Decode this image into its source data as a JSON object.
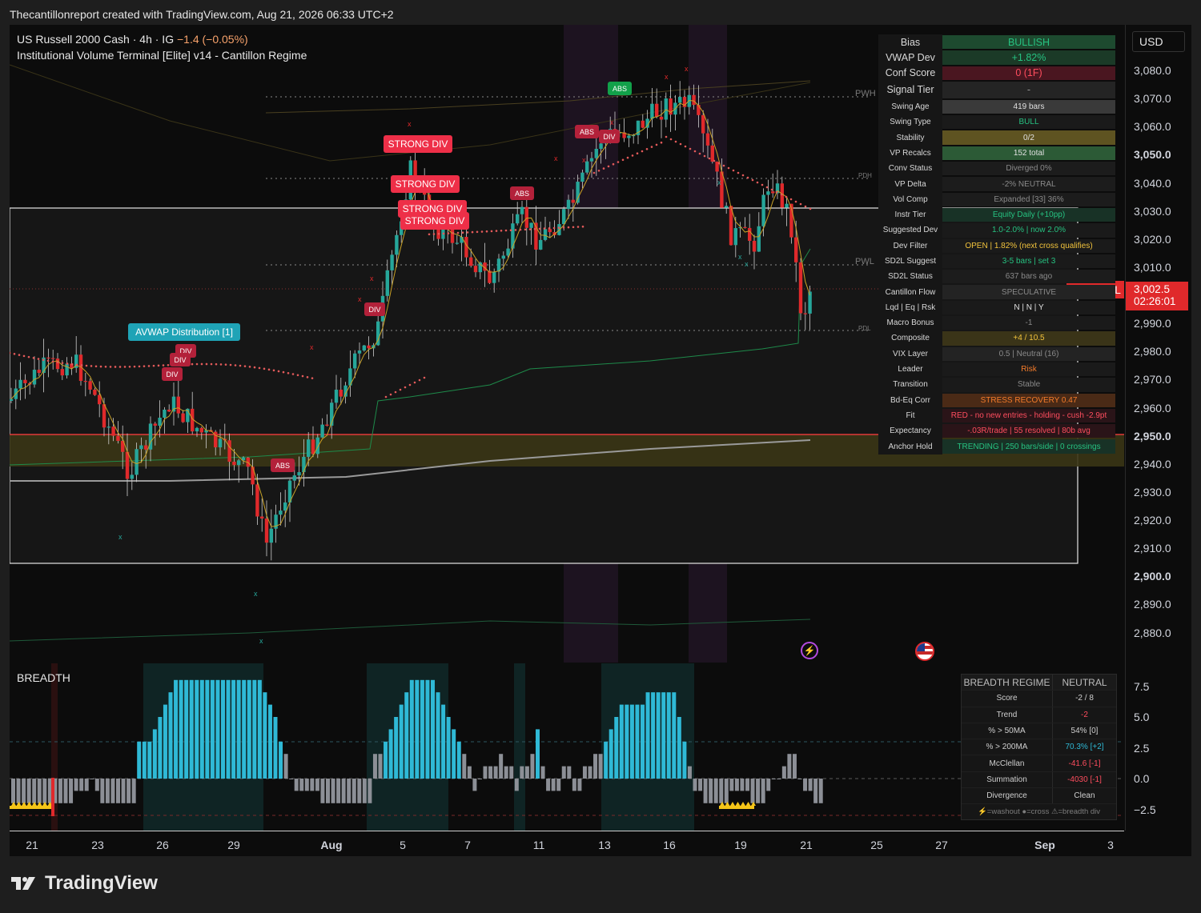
{
  "header": {
    "credit": "Thecantillonreport created with TradingView.com, Aug 21, 2026 06:33 UTC+2"
  },
  "symbol": {
    "title": "US Russell 2000 Cash · 4h · IG",
    "change": "−1.4 (−0.05%)"
  },
  "indicator": {
    "title": "Institutional Volume Terminal [Elite] v14 - Cantillon Regime"
  },
  "axis": {
    "currency": "USD",
    "price_labels": [
      {
        "v": 3080,
        "t": "3,080.0"
      },
      {
        "v": 3070,
        "t": "3,070.0"
      },
      {
        "v": 3060,
        "t": "3,060.0"
      },
      {
        "v": 3050,
        "t": "3,050.0",
        "bold": true
      },
      {
        "v": 3040,
        "t": "3,040.0"
      },
      {
        "v": 3030,
        "t": "3,030.0"
      },
      {
        "v": 3020,
        "t": "3,020.0"
      },
      {
        "v": 3010,
        "t": "3,010.0"
      },
      {
        "v": 2990,
        "t": "2,990.0"
      },
      {
        "v": 2980,
        "t": "2,980.0"
      },
      {
        "v": 2970,
        "t": "2,970.0"
      },
      {
        "v": 2960,
        "t": "2,960.0"
      },
      {
        "v": 2950,
        "t": "2,950.0",
        "bold": true
      },
      {
        "v": 2940,
        "t": "2,940.0"
      },
      {
        "v": 2930,
        "t": "2,930.0"
      },
      {
        "v": 2920,
        "t": "2,920.0"
      },
      {
        "v": 2910,
        "t": "2,910.0"
      },
      {
        "v": 2900,
        "t": "2,900.0",
        "bold": true
      },
      {
        "v": 2890,
        "t": "2,890.0"
      },
      {
        "v": 2880,
        "t": "2,880.0"
      }
    ],
    "last_price": "3,002.5",
    "countdown": "02:26:01",
    "price_tag_label": "RUSSELL",
    "breadth_labels": [
      "7.5",
      "5.0",
      "2.5",
      "0.0",
      "−2.5"
    ],
    "dates": [
      {
        "t": "21"
      },
      {
        "t": "23"
      },
      {
        "t": "26"
      },
      {
        "t": "29"
      },
      {
        "t": "Aug",
        "bold": true
      },
      {
        "t": "5"
      },
      {
        "t": "7"
      },
      {
        "t": "11"
      },
      {
        "t": "13"
      },
      {
        "t": "16"
      },
      {
        "t": "19"
      },
      {
        "t": "21"
      },
      {
        "t": "25"
      },
      {
        "t": "27"
      },
      {
        "t": "Sep",
        "bold": true
      },
      {
        "t": "3"
      }
    ]
  },
  "levels": {
    "pwh": "PWH",
    "pdh": "PDH",
    "pwl": "PWL",
    "pdl": "PDL"
  },
  "annotations": {
    "avwap": "AVWAP Distribution [1]",
    "strong_div": "STRONG DIV",
    "div": "DIV",
    "abs": "ABS",
    "x": "x"
  },
  "terminal": [
    {
      "k": "Bias",
      "v": "BULLISH",
      "c": "#26c281",
      "bg": "#1d4a2f",
      "big": true
    },
    {
      "k": "VWAP Dev",
      "v": "+1.82%",
      "c": "#26c281",
      "bg": "#1b3a27",
      "big": true
    },
    {
      "k": "Conf Score",
      "v": "0 (1F)",
      "c": "#ff4d5e",
      "bg": "#4a1620",
      "big": true
    },
    {
      "k": "Signal Tier",
      "v": "-",
      "c": "#9a9a9a",
      "bg": "#242424",
      "big": true
    },
    {
      "k": "Swing Age",
      "v": "419 bars",
      "c": "#e0e0e0",
      "bg": "#3a3a3a"
    },
    {
      "k": "Swing Type",
      "v": "BULL",
      "c": "#26c281",
      "bg": "#1a1a1a"
    },
    {
      "k": "Stability",
      "v": "0/2",
      "c": "#e0e0e0",
      "bg": "#5e5321"
    },
    {
      "k": "VP Recalcs",
      "v": "152 total",
      "c": "#e0e0e0",
      "bg": "#2c5a36"
    },
    {
      "k": "Conv Status",
      "v": "Diverged 0%",
      "c": "#8a8a8a",
      "bg": "#1c1c1c"
    },
    {
      "k": "VP Delta",
      "v": "-2% NEUTRAL",
      "c": "#8a8a8a",
      "bg": "#1c1c1c"
    },
    {
      "k": "Vol Comp",
      "v": "Expanded [33] 36%",
      "c": "#8a8a8a",
      "bg": "#1c1c1c"
    },
    {
      "k": "Instr Tier",
      "v": "Equity Daily (+10pp)",
      "c": "#26c281",
      "bg": "#183226"
    },
    {
      "k": "Suggested Dev",
      "v": "1.0-2.0% | now 2.0%",
      "c": "#26c281",
      "bg": "#1a1a1a"
    },
    {
      "k": "Dev Filter",
      "v": "OPEN | 1.82% (next cross qualifies)",
      "c": "#f2c33c",
      "bg": "#1a1a1a"
    },
    {
      "k": "SD2L Suggest",
      "v": "3-5 bars | set 3",
      "c": "#26c281",
      "bg": "#1a1a1a"
    },
    {
      "k": "SD2L Status",
      "v": "637 bars ago",
      "c": "#8a8a8a",
      "bg": "#1c1c1c"
    },
    {
      "k": "Cantillon Flow",
      "v": "SPECULATIVE",
      "c": "#8a8a8a",
      "bg": "#232323"
    },
    {
      "k": "Lqd | Eq | Rsk",
      "v": "N | N | Y",
      "c": "#e0e0e0",
      "bg": "#1a1a1a"
    },
    {
      "k": "Macro Bonus",
      "v": "-1",
      "c": "#8a8a8a",
      "bg": "#1a1a1a"
    },
    {
      "k": "Composite",
      "v": "+4 / 10.5",
      "c": "#f2c33c",
      "bg": "#3a3418"
    },
    {
      "k": "VIX Layer",
      "v": "0.5 | Neutral (16)",
      "c": "#8a8a8a",
      "bg": "#232323"
    },
    {
      "k": "Leader",
      "v": "Risk",
      "c": "#f57c2a",
      "bg": "#1a1a1a"
    },
    {
      "k": "Transition",
      "v": "Stable",
      "c": "#8a8a8a",
      "bg": "#1a1a1a"
    },
    {
      "k": "Bd-Eq Corr",
      "v": "STRESS RECOVERY 0.47",
      "c": "#f57c2a",
      "bg": "#4a2a16"
    },
    {
      "k": "Fit",
      "v": "RED - no new entries - holding - cush -2.9pt",
      "c": "#ff4d5e",
      "bg": "#2a1418"
    },
    {
      "k": "Expectancy",
      "v": "-.03R/trade | 55 resolved | 80b avg",
      "c": "#ff4d5e",
      "bg": "#2a1418"
    },
    {
      "k": "Anchor Hold",
      "v": "TRENDING | 250 bars/side | 0 crossings",
      "c": "#26c281",
      "bg": "#183226"
    }
  ],
  "breadth": {
    "label": "BREADTH",
    "header": {
      "k": "BREADTH REGIME",
      "v": "NEUTRAL"
    },
    "rows": [
      {
        "k": "Score",
        "v": "-2 / 8",
        "c": "#cfcfcf"
      },
      {
        "k": "Trend",
        "v": "-2",
        "c": "#ff4d5e"
      },
      {
        "k": "% > 50MA",
        "v": "54%  [0]",
        "c": "#cfcfcf"
      },
      {
        "k": "% > 200MA",
        "v": "70.3%  [+2]",
        "c": "#2fb9d6"
      },
      {
        "k": "McClellan",
        "v": "-41.6  [-1]",
        "c": "#ff4d5e"
      },
      {
        "k": "Summation",
        "v": "-4030  [-1]",
        "c": "#ff4d5e"
      },
      {
        "k": "Divergence",
        "v": "Clean",
        "c": "#cfcfcf"
      }
    ],
    "footer": "⚡=washout  ●=cross  ⚠=breadth div"
  },
  "brand": {
    "name": "TradingView"
  },
  "colors": {
    "bull": "#26a69a",
    "bear": "#e0292b",
    "cyan": "#2fb9d6",
    "grey": "#8c8f96"
  }
}
